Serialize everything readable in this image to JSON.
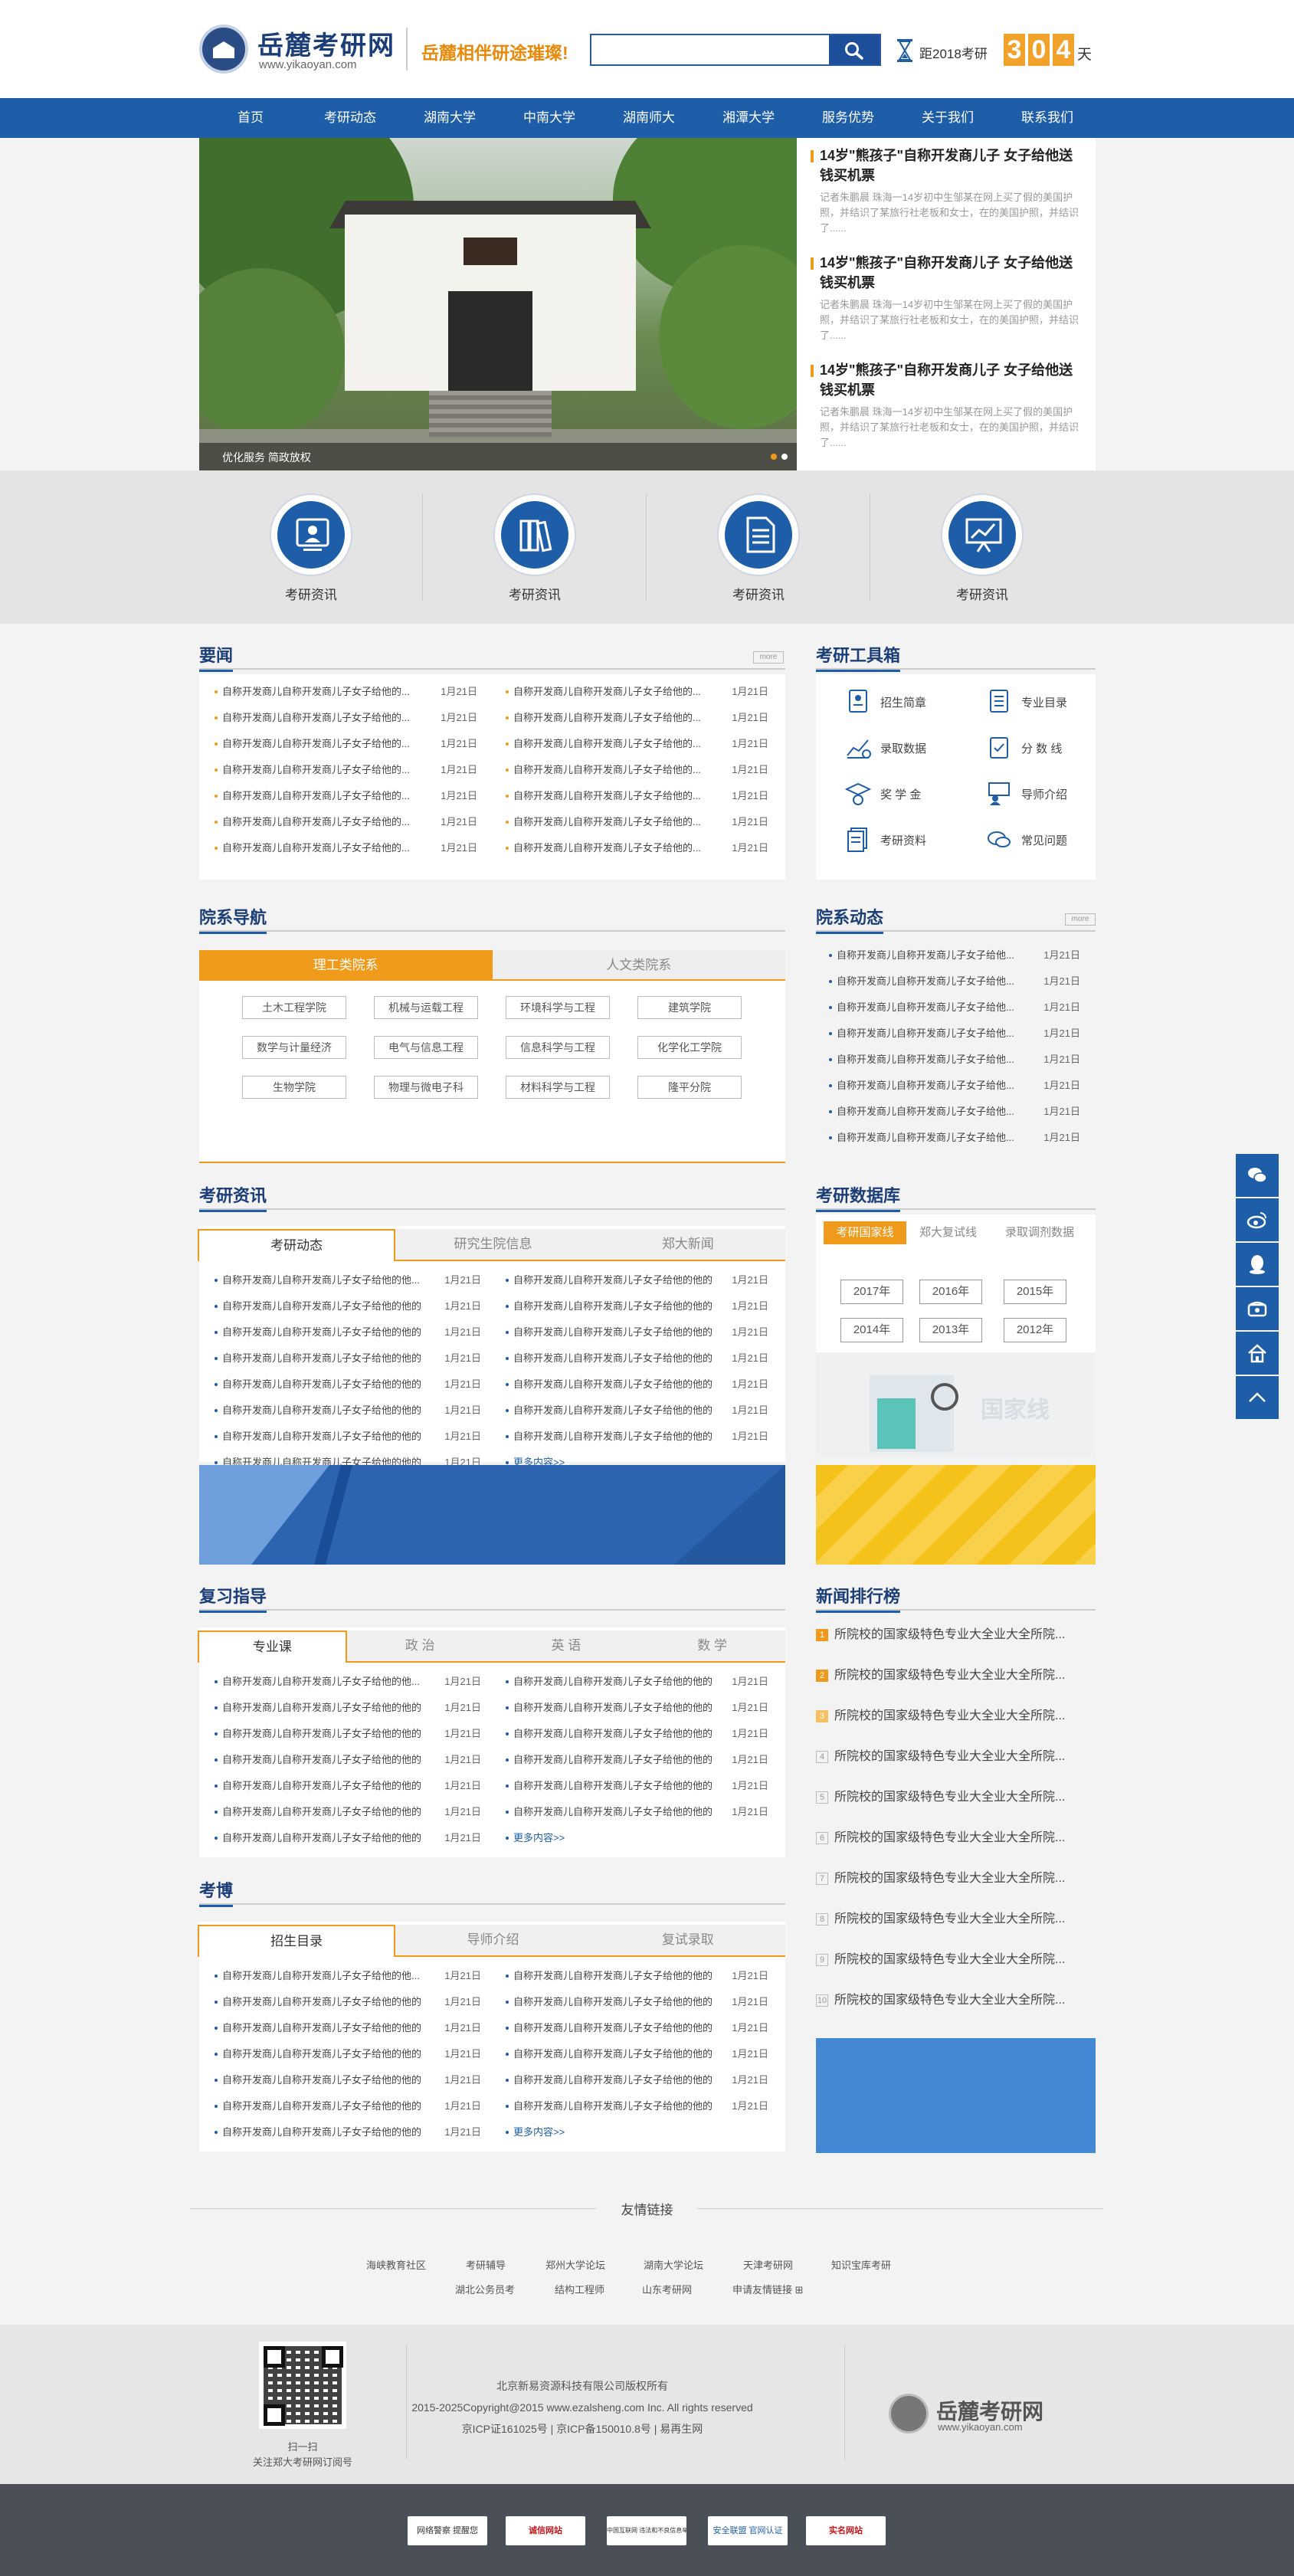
{
  "header": {
    "logo_cn": "岳麓考研网",
    "logo_en": "www.yikaoyan.com",
    "slogan": "岳麓相伴研途璀璨!",
    "search_placeholder": "",
    "countdown_label": "距2018考研",
    "countdown_digits": [
      "3",
      "0",
      "4"
    ],
    "countdown_unit": "天"
  },
  "nav": [
    "首页",
    "考研动态",
    "湖南大学",
    "中南大学",
    "湖南师大",
    "湘潭大学",
    "服务优势",
    "关于我们",
    "联系我们"
  ],
  "banner": {
    "caption": "优化服务 简政放权"
  },
  "top_news": [
    {
      "title": "14岁\"熊孩子\"自称开发商儿子 女子给他送钱买机票",
      "summary": "记者朱鹏晨 珠海一14岁初中生邹某在网上买了假的美国护照，并结识了某旅行社老板和女士，在的美国护照，并结识了......"
    },
    {
      "title": "14岁\"熊孩子\"自称开发商儿子 女子给他送钱买机票",
      "summary": "记者朱鹏晨 珠海一14岁初中生邹某在网上买了假的美国护照，并结识了某旅行社老板和女士，在的美国护照，并结识了......"
    },
    {
      "title": "14岁\"熊孩子\"自称开发商儿子 女子给他送钱买机票",
      "summary": "记者朱鹏晨 珠海一14岁初中生邹某在网上买了假的美国护照，并结识了某旅行社老板和女士，在的美国护照，并结识了......"
    }
  ],
  "band": [
    "考研资讯",
    "考研资讯",
    "考研资讯",
    "考研资讯"
  ],
  "yaowen": {
    "title": "要闻",
    "more": "more",
    "left": [
      "自称开发商儿自称开发商儿子女子给他的...",
      "自称开发商儿自称开发商儿子女子给他的...",
      "自称开发商儿自称开发商儿子女子给他的...",
      "自称开发商儿自称开发商儿子女子给他的...",
      "自称开发商儿自称开发商儿子女子给他的...",
      "自称开发商儿自称开发商儿子女子给他的...",
      "自称开发商儿自称开发商儿子女子给他的..."
    ],
    "right": [
      "自称开发商儿自称开发商儿子女子给他的...",
      "自称开发商儿自称开发商儿子女子给他的...",
      "自称开发商儿自称开发商儿子女子给他的...",
      "自称开发商儿自称开发商儿子女子给他的...",
      "自称开发商儿自称开发商儿子女子给他的...",
      "自称开发商儿自称开发商儿子女子给他的...",
      "自称开发商儿自称开发商儿子女子给他的..."
    ],
    "date": "1月21日"
  },
  "tools": {
    "title": "考研工具箱",
    "items": [
      "招生简章",
      "专业目录",
      "录取数据",
      "分 数 线",
      "奖 学 金",
      "导师介绍",
      "考研资料",
      "常见问题"
    ]
  },
  "depts": {
    "title": "院系导航",
    "tabs": [
      "理工类院系",
      "人文类院系"
    ],
    "tags": [
      "土木工程学院",
      "机械与运载工程",
      "环境科学与工程",
      "建筑学院",
      "数学与计量经济",
      "电气与信息工程",
      "信息科学与工程",
      "化学化工学院",
      "生物学院",
      "物理与微电子科",
      "材料科学与工程",
      "隆平分院"
    ]
  },
  "deptnews": {
    "title": "院系动态",
    "more": "more",
    "items": [
      "自称开发商儿自称开发商儿子女子给他...",
      "自称开发商儿自称开发商儿子女子给他...",
      "自称开发商儿自称开发商儿子女子给他...",
      "自称开发商儿自称开发商儿子女子给他...",
      "自称开发商儿自称开发商儿子女子给他...",
      "自称开发商儿自称开发商儿子女子给他...",
      "自称开发商儿自称开发商儿子女子给他...",
      "自称开发商儿自称开发商儿子女子给他..."
    ],
    "date": "1月21日"
  },
  "zixun": {
    "title": "考研资讯",
    "tabs": [
      "考研动态",
      "研究生院信息",
      "郑大新闻"
    ],
    "left": [
      "自称开发商儿自称开发商儿子女子给他的他...",
      "自称开发商儿自称开发商儿子女子给他的他的",
      "自称开发商儿自称开发商儿子女子给他的他的",
      "自称开发商儿自称开发商儿子女子给他的他的",
      "自称开发商儿自称开发商儿子女子给他的他的",
      "自称开发商儿自称开发商儿子女子给他的他的",
      "自称开发商儿自称开发商儿子女子给他的他的",
      "自称开发商儿自称开发商儿子女子给他的他的"
    ],
    "right": [
      "自称开发商儿自称开发商儿子女子给他的他的",
      "自称开发商儿自称开发商儿子女子给他的他的",
      "自称开发商儿自称开发商儿子女子给他的他的",
      "自称开发商儿自称开发商儿子女子给他的他的",
      "自称开发商儿自称开发商儿子女子给他的他的",
      "自称开发商儿自称开发商儿子女子给他的他的",
      "自称开发商儿自称开发商儿子女子给他的他的"
    ],
    "more": "更多内容>>",
    "date": "1月21日"
  },
  "database": {
    "title": "考研数据库",
    "tabs": [
      "考研国家线",
      "郑大复试线",
      "录取调剂数据"
    ],
    "years": [
      "2017年",
      "2016年",
      "2015年",
      "2014年",
      "2013年",
      "2012年"
    ],
    "illus_text": "国家线"
  },
  "fuxi": {
    "title": "复习指导",
    "tabs": [
      "专业课",
      "政 治",
      "英 语",
      "数 学"
    ],
    "left": [
      "自称开发商儿自称开发商儿子女子给他的他...",
      "自称开发商儿自称开发商儿子女子给他的他的",
      "自称开发商儿自称开发商儿子女子给他的他的",
      "自称开发商儿自称开发商儿子女子给他的他的",
      "自称开发商儿自称开发商儿子女子给他的他的",
      "自称开发商儿自称开发商儿子女子给他的他的",
      "自称开发商儿自称开发商儿子女子给他的他的"
    ],
    "right": [
      "自称开发商儿自称开发商儿子女子给他的他的",
      "自称开发商儿自称开发商儿子女子给他的他的",
      "自称开发商儿自称开发商儿子女子给他的他的",
      "自称开发商儿自称开发商儿子女子给他的他的",
      "自称开发商儿自称开发商儿子女子给他的他的",
      "自称开发商儿自称开发商儿子女子给他的他的"
    ],
    "more": "更多内容>>",
    "date": "1月21日"
  },
  "rank": {
    "title": "新闻排行榜",
    "nums": [
      "1",
      "2",
      "3",
      "4",
      "5",
      "6",
      "7",
      "8",
      "9",
      "10"
    ],
    "items": [
      "所院校的国家级特色专业大全业大全所院...",
      "所院校的国家级特色专业大全业大全所院...",
      "所院校的国家级特色专业大全业大全所院...",
      "所院校的国家级特色专业大全业大全所院...",
      "所院校的国家级特色专业大全业大全所院...",
      "所院校的国家级特色专业大全业大全所院...",
      "所院校的国家级特色专业大全业大全所院...",
      "所院校的国家级特色专业大全业大全所院...",
      "所院校的国家级特色专业大全业大全所院...",
      "所院校的国家级特色专业大全业大全所院..."
    ]
  },
  "kaobo": {
    "title": "考博",
    "tabs": [
      "招生目录",
      "导师介绍",
      "复试录取"
    ],
    "left": [
      "自称开发商儿自称开发商儿子女子给他的他...",
      "自称开发商儿自称开发商儿子女子给他的他的",
      "自称开发商儿自称开发商儿子女子给他的他的",
      "自称开发商儿自称开发商儿子女子给他的他的",
      "自称开发商儿自称开发商儿子女子给他的他的",
      "自称开发商儿自称开发商儿子女子给他的他的",
      "自称开发商儿自称开发商儿子女子给他的他的"
    ],
    "right": [
      "自称开发商儿自称开发商儿子女子给他的他的",
      "自称开发商儿自称开发商儿子女子给他的他的",
      "自称开发商儿自称开发商儿子女子给他的他的",
      "自称开发商儿自称开发商儿子女子给他的他的",
      "自称开发商儿自称开发商儿子女子给他的他的",
      "自称开发商儿自称开发商儿子女子给他的他的"
    ],
    "more": "更多内容>>",
    "date": "1月21日"
  },
  "friend_links": {
    "title": "友情链接",
    "row1": [
      "海峡教育社区",
      "考研辅导",
      "郑州大学论坛",
      "湖南大学论坛",
      "天津考研网",
      "知识宝库考研"
    ],
    "row2": [
      "湖北公务员考",
      "结构工程师",
      "山东考研网",
      "申请友情链接 ⊞"
    ]
  },
  "footer": {
    "qr_caption1": "扫一扫",
    "qr_caption2": "关注郑大考研网订阅号",
    "copy1": "北京新易资源科技有限公司版权所有",
    "copy2": "2015-2025Copyright@2015 www.ezalsheng.com Inc. All rights reserved",
    "copy3": "京ICP证161025号 | 京ICP备150010.8号 | 易再生网",
    "logo_cn": "岳麓考研网",
    "logo_en": "www.yikaoyan.com"
  },
  "badges": [
    "网络警察 提醒您",
    "诚信网站",
    "中国互联网 违法和不良信息举报中心",
    "安全联盟 官网认证",
    "实名网站"
  ],
  "colors": {
    "primary": "#1e5ea8",
    "accent": "#f09a1c",
    "title": "#1c3e78"
  }
}
